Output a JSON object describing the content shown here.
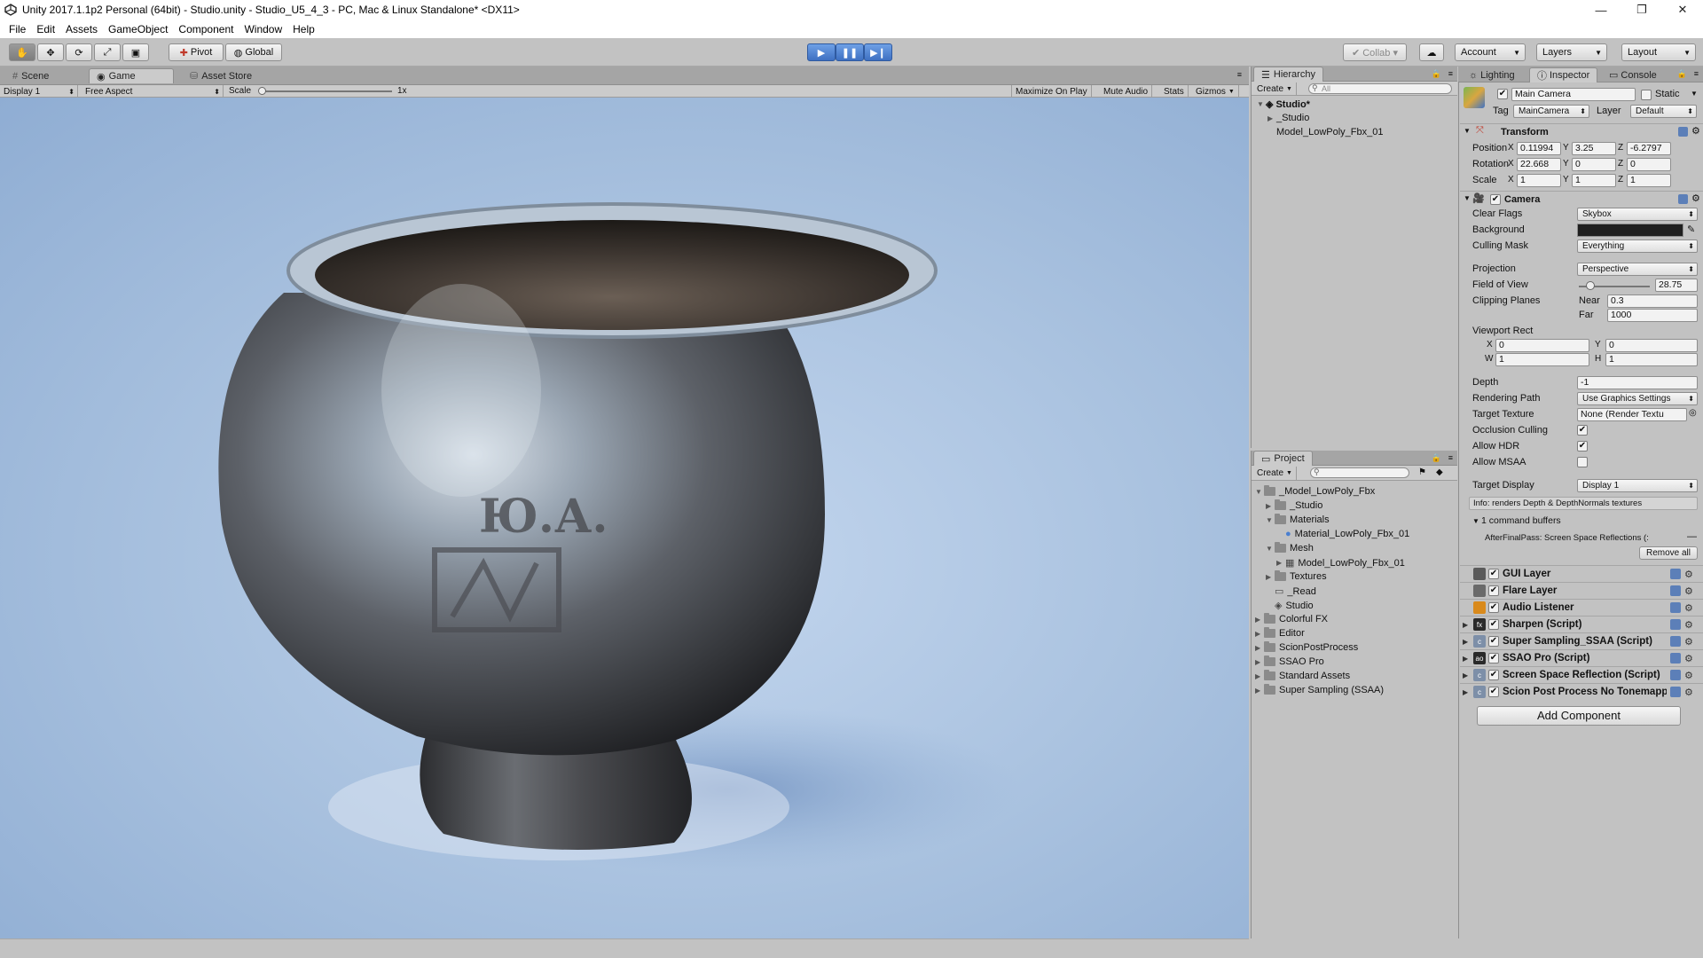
{
  "window": {
    "title": "Unity 2017.1.1p2 Personal (64bit) - Studio.unity - Studio_U5_4_3 - PC, Mac & Linux Standalone* <DX11>",
    "minimize": "—",
    "maximize": "❐",
    "close": "✕"
  },
  "menu": [
    "File",
    "Edit",
    "Assets",
    "GameObject",
    "Component",
    "Window",
    "Help"
  ],
  "toolbar": {
    "pivot": "Pivot",
    "global": "Global",
    "collab": "Collab ▾",
    "account": "Account",
    "layers": "Layers",
    "layout": "Layout"
  },
  "game": {
    "tabs": {
      "scene": "Scene",
      "game": "Game",
      "asset_store": "Asset Store"
    },
    "display": "Display 1",
    "aspect": "Free Aspect",
    "scale_label": "Scale",
    "scale_value": "1x",
    "scale_fraction": 0.02,
    "buttons": [
      "Maximize On Play",
      "Mute Audio",
      "Stats",
      "Gizmos"
    ]
  },
  "hierarchy": {
    "tab": "Hierarchy",
    "create": "Create",
    "search_placeholder": "All",
    "scene": "Studio*",
    "items": [
      "_Studio",
      "Model_LowPoly_Fbx_01"
    ]
  },
  "project": {
    "tab": "Project",
    "create": "Create",
    "tree": [
      {
        "label": "_Model_LowPoly_Fbx",
        "arrow": "▼",
        "icon": "folder"
      },
      {
        "label": "_Studio",
        "arrow": "▶",
        "icon": "folder"
      },
      {
        "label": "Materials",
        "arrow": "▼",
        "icon": "folder"
      },
      {
        "label": "Material_LowPoly_Fbx_01",
        "arrow": "",
        "icon": "material"
      },
      {
        "label": "Mesh",
        "arrow": "▼",
        "icon": "folder"
      },
      {
        "label": "Model_LowPoly_Fbx_01",
        "arrow": "▶",
        "icon": "mesh"
      },
      {
        "label": "Textures",
        "arrow": "▶",
        "icon": "folder"
      },
      {
        "label": "_Read",
        "arrow": "",
        "icon": "doc"
      },
      {
        "label": "Studio",
        "arrow": "",
        "icon": "scene"
      },
      {
        "label": "Colorful FX",
        "arrow": "▶",
        "icon": "folder"
      },
      {
        "label": "Editor",
        "arrow": "▶",
        "icon": "folder"
      },
      {
        "label": "ScionPostProcess",
        "arrow": "▶",
        "icon": "folder"
      },
      {
        "label": "SSAO Pro",
        "arrow": "▶",
        "icon": "folder"
      },
      {
        "label": "Standard Assets",
        "arrow": "▶",
        "icon": "folder"
      },
      {
        "label": "Super Sampling (SSAA)",
        "arrow": "▶",
        "icon": "folder"
      }
    ]
  },
  "inspector": {
    "tabs": {
      "lighting": "Lighting",
      "inspector": "Inspector",
      "console": "Console"
    },
    "object_name": "Main Camera",
    "static": "Static",
    "tag_label": "Tag",
    "tag": "MainCamera",
    "layer_label": "Layer",
    "layer": "Default",
    "transform": {
      "title": "Transform",
      "position_label": "Position",
      "position": [
        "0.11994",
        "3.25",
        "-6.2797"
      ],
      "rotation_label": "Rotation",
      "rotation": [
        "22.668",
        "0",
        "0"
      ],
      "scale_label": "Scale",
      "scale": [
        "1",
        "1",
        "1"
      ],
      "axis": [
        "X",
        "Y",
        "Z"
      ]
    },
    "camera": {
      "title": "Camera",
      "clear_flags_label": "Clear Flags",
      "clear_flags": "Skybox",
      "background_label": "Background",
      "culling_mask_label": "Culling Mask",
      "culling_mask": "Everything",
      "projection_label": "Projection",
      "projection": "Perspective",
      "fov_label": "Field of View",
      "fov": "28.75",
      "fov_fraction": 0.16,
      "clipping_label": "Clipping Planes",
      "near_label": "Near",
      "near": "0.3",
      "far_label": "Far",
      "far": "1000",
      "viewport_label": "Viewport Rect",
      "vx_label": "X",
      "vx": "0",
      "vy_label": "Y",
      "vy": "0",
      "vw_label": "W",
      "vw": "1",
      "vh_label": "H",
      "vh": "1",
      "depth_label": "Depth",
      "depth": "-1",
      "rendering_path_label": "Rendering Path",
      "rendering_path": "Use Graphics Settings",
      "target_texture_label": "Target Texture",
      "target_texture": "None (Render Textu",
      "occlusion_label": "Occlusion Culling",
      "hdr_label": "Allow HDR",
      "msaa_label": "Allow MSAA",
      "target_display_label": "Target Display",
      "target_display": "Display 1",
      "info": "Info: renders Depth & DepthNormals textures",
      "command_buffers": "1 command buffers",
      "after_final": "AfterFinalPass: Screen Space Reflections (:",
      "remove_all": "Remove all"
    },
    "components": [
      {
        "name": "GUI Layer",
        "arrow": "",
        "icon": "#5a5a5a",
        "glyph": ""
      },
      {
        "name": "Flare Layer",
        "arrow": "",
        "icon": "#6a6a6a",
        "glyph": ""
      },
      {
        "name": "Audio Listener",
        "arrow": "",
        "icon": "#d98a1c",
        "glyph": ""
      },
      {
        "name": "Sharpen (Script)",
        "arrow": "▶",
        "icon": "#2a2a2a",
        "glyph": "fx"
      },
      {
        "name": "Super Sampling_SSAA (Script)",
        "arrow": "▶",
        "icon": "#7d8fa8",
        "glyph": "c"
      },
      {
        "name": "SSAO Pro (Script)",
        "arrow": "▶",
        "icon": "#2a2a2a",
        "glyph": "ao"
      },
      {
        "name": "Screen Space Reflection (Script)",
        "arrow": "▶",
        "icon": "#7d8fa8",
        "glyph": "c"
      },
      {
        "name": "Scion Post Process No Tonemapping",
        "arrow": "▶",
        "icon": "#7d8fa8",
        "glyph": "c"
      }
    ],
    "add_component": "Add Component"
  },
  "colors": {
    "play_blue": "#4a7fd0",
    "viewport_bg": "#a7c0de",
    "panel_bg": "#c2c2c2"
  }
}
